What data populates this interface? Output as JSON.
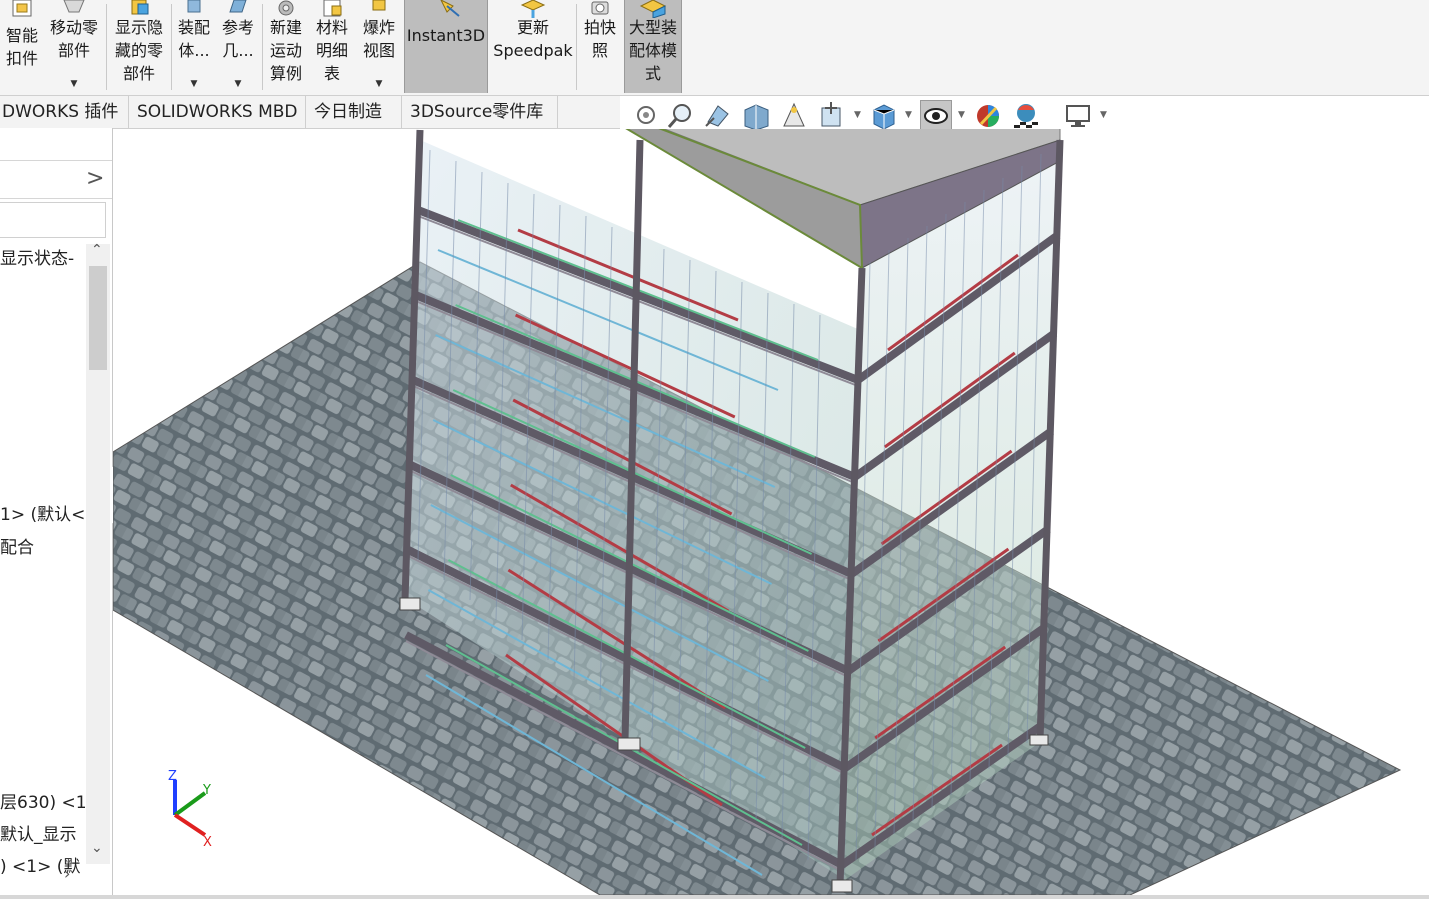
{
  "ribbon": {
    "buttons": [
      {
        "label": "智能\n扣件",
        "icon": "smart-fasteners-icon"
      },
      {
        "label": "移动零\n部件",
        "icon": "move-component-icon",
        "dropdown": true
      },
      {
        "label": "显示隐\n藏的零\n部件",
        "icon": "show-hidden-components-icon"
      },
      {
        "label": "装配\n体...",
        "icon": "assembly-features-icon",
        "dropdown": true
      },
      {
        "label": "参考\n几...",
        "icon": "reference-geometry-icon",
        "dropdown": true
      },
      {
        "label": "新建\n运动\n算例",
        "icon": "new-motion-study-icon"
      },
      {
        "label": "材料\n明细\n表",
        "icon": "bill-of-materials-icon"
      },
      {
        "label": "爆炸\n视图",
        "icon": "exploded-view-icon",
        "dropdown": true
      },
      {
        "label": "Instant3D",
        "icon": "instant3d-icon",
        "active": true
      },
      {
        "label": "更新\nSpeedpak",
        "icon": "update-speedpak-icon"
      },
      {
        "label": "拍快\n照",
        "icon": "snapshot-icon"
      },
      {
        "label": "大型装\n配体模\n式",
        "icon": "large-assembly-mode-icon",
        "active": true
      }
    ]
  },
  "tabs": [
    "DWORKS 插件",
    "SOLIDWORKS MBD",
    "今日制造",
    "3DSource零件库"
  ],
  "hud": [
    "zoom-to-fit-icon",
    "zoom-to-area-icon",
    "previous-view-icon",
    "section-view-icon",
    "dynamic-annotation-icon",
    "view-orientation-icon",
    "display-style-icon",
    "hide-show-items-icon",
    "edit-appearance-icon",
    "apply-scene-icon",
    "view-settings-icon"
  ],
  "panel": {
    "expand": ">",
    "items": [
      {
        "text": "显示状态-"
      },
      {
        "text": "1> (默认<"
      },
      {
        "text": "配合"
      },
      {
        "text": "层630)  <1"
      },
      {
        "text": "默认_显示"
      },
      {
        "text": ")  <1> (默"
      }
    ]
  },
  "triad": {
    "x": "X",
    "y": "Y",
    "z": "Z"
  },
  "colors": {
    "ribbon_bg": "#f4f4f4",
    "active_btn": "#bdbdbd",
    "frame": "#6f6a72",
    "floor": "#6e7a80"
  }
}
